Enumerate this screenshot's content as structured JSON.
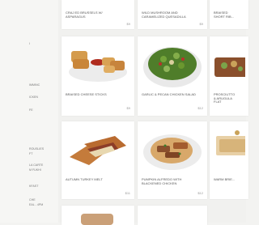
{
  "sidebar": {
    "items": [
      {
        "label": "I"
      },
      {
        "label": "IMMINC"
      },
      {
        "label": "ICKEN"
      },
      {
        "label": "FE"
      },
      {
        "label": "ROUSLIES"
      },
      {
        "label": "FT"
      },
      {
        "label": "LA CARTE"
      },
      {
        "label": "M FUKHI"
      },
      {
        "label": "KFAST"
      },
      {
        "label": "CHE"
      },
      {
        "label": "EAL - 4PM"
      }
    ]
  },
  "top_row": [
    {
      "title": "CRAJ ED BRUSSELS W/ ASPARAGUS",
      "price": "$9"
    },
    {
      "title": "WILD MUSHROOM AND CARAMELIZED QUESADILLA",
      "price": "$9"
    },
    {
      "title": "BRAISED SHORT RIB...",
      "price": ""
    }
  ],
  "middle_row": [
    {
      "title": "BRAISED CHEESE STICKS",
      "price": "$9",
      "image": "fried-cheese-sticks-photo"
    },
    {
      "title": "GARLIC & PECAN CHICKEN SALAD",
      "price": "$12",
      "image": "green-salad-bowl-photo"
    },
    {
      "title": "PROSCIUTTO & ARUGULA FLAT",
      "price": "",
      "image": "flatbread-photo"
    }
  ],
  "bottom_row": [
    {
      "title": "AUTUMN TURKEY MELT",
      "price": "$11",
      "image": "panini-photo"
    },
    {
      "title": "PUMPKIN ALFREDO WITH BLACKENED CHICKEN",
      "price": "$12",
      "image": "pasta-plate-photo"
    },
    {
      "title": "WARM BRIE...",
      "price": "",
      "image": "cheese-plate-photo"
    }
  ]
}
